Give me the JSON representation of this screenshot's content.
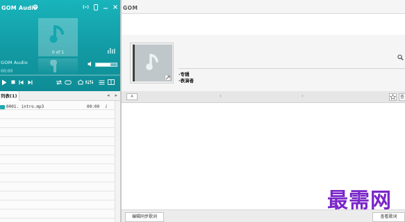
{
  "app": {
    "title": "GOM Audio",
    "brand_short": "GOM"
  },
  "player": {
    "track_count": "0 of 1",
    "now_playing": "GOM Audio",
    "time": "00:00",
    "volume_level": 0.7,
    "icons": [
      "gear-icon",
      "broadcast-icon",
      "phone-icon",
      "minimize-icon",
      "close-icon",
      "music-note-icon",
      "equalizer-icon",
      "volume-icon",
      "play-icon",
      "stop-icon",
      "previous-icon",
      "next-icon",
      "repeat-icon",
      "shuffle-icon",
      "playlist-icon",
      "menu-icon"
    ]
  },
  "playlist": {
    "tab_label": "列表(1)",
    "items": [
      {
        "name": "0001. intro.mp3",
        "duration": "00:00",
        "info": "i"
      }
    ]
  },
  "info": {
    "album_label": "·专辑",
    "artist_label": "·表演者"
  },
  "lyrics": {
    "lang_label": "A",
    "prev": "‹",
    "next": "›",
    "more_label": "查",
    "edit_button": "编辑同步歌词",
    "view_button": "查看歌词"
  },
  "watermark": "最需网",
  "colors": {
    "player_teal": "#129aa3",
    "watermark": "#7a26c9"
  }
}
